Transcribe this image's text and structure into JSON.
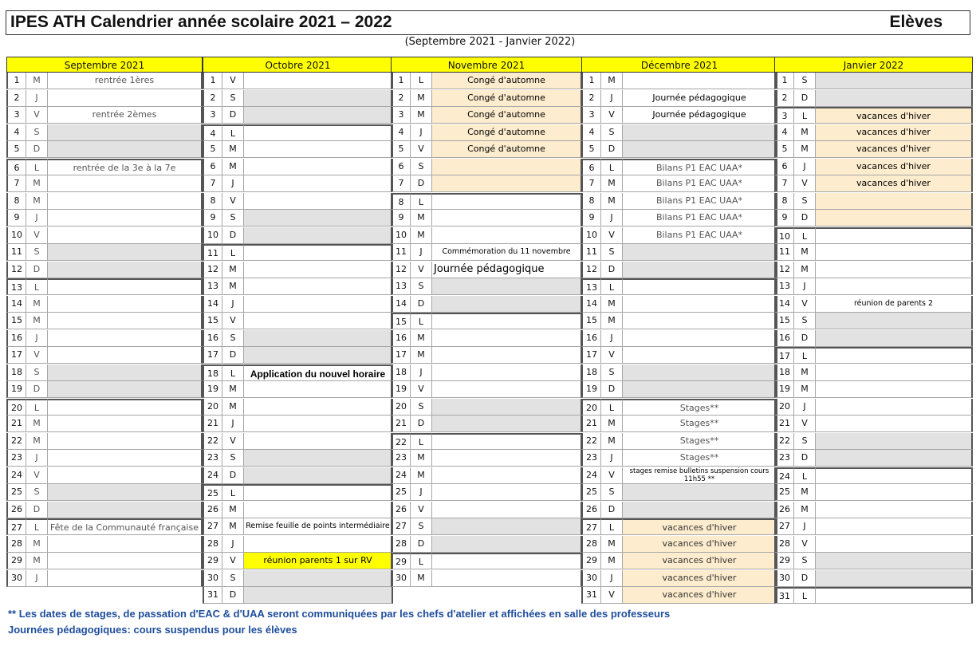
{
  "header": {
    "title": "IPES ATH Calendrier année scolaire 2021 – 2022",
    "audience": "Elèves"
  },
  "subtitle": "(Septembre 2021 - Janvier 2022)",
  "months": [
    {
      "name": "Septembre 2021",
      "days": [
        {
          "d": "1",
          "w": "M",
          "e": "rentrée 1ères"
        },
        {
          "d": "2",
          "w": "J",
          "e": ""
        },
        {
          "d": "3",
          "w": "V",
          "e": "rentrée 2èmes"
        },
        {
          "d": "4",
          "w": "S",
          "e": ""
        },
        {
          "d": "5",
          "w": "D",
          "e": ""
        },
        {
          "d": "6",
          "w": "L",
          "e": "rentrée de la 3e à la 7e"
        },
        {
          "d": "7",
          "w": "M",
          "e": ""
        },
        {
          "d": "8",
          "w": "M",
          "e": ""
        },
        {
          "d": "9",
          "w": "J",
          "e": ""
        },
        {
          "d": "10",
          "w": "V",
          "e": ""
        },
        {
          "d": "11",
          "w": "S",
          "e": ""
        },
        {
          "d": "12",
          "w": "D",
          "e": ""
        },
        {
          "d": "13",
          "w": "L",
          "e": ""
        },
        {
          "d": "14",
          "w": "M",
          "e": ""
        },
        {
          "d": "15",
          "w": "M",
          "e": ""
        },
        {
          "d": "16",
          "w": "J",
          "e": ""
        },
        {
          "d": "17",
          "w": "V",
          "e": ""
        },
        {
          "d": "18",
          "w": "S",
          "e": ""
        },
        {
          "d": "19",
          "w": "D",
          "e": ""
        },
        {
          "d": "20",
          "w": "L",
          "e": ""
        },
        {
          "d": "21",
          "w": "M",
          "e": ""
        },
        {
          "d": "22",
          "w": "M",
          "e": ""
        },
        {
          "d": "23",
          "w": "J",
          "e": ""
        },
        {
          "d": "24",
          "w": "V",
          "e": ""
        },
        {
          "d": "25",
          "w": "S",
          "e": ""
        },
        {
          "d": "26",
          "w": "D",
          "e": ""
        },
        {
          "d": "27",
          "w": "L",
          "e": "Fête de la Communauté française"
        },
        {
          "d": "28",
          "w": "M",
          "e": ""
        },
        {
          "d": "29",
          "w": "M",
          "e": ""
        },
        {
          "d": "30",
          "w": "J",
          "e": ""
        }
      ]
    },
    {
      "name": "Octobre 2021",
      "days": [
        {
          "d": "1",
          "w": "V",
          "e": ""
        },
        {
          "d": "2",
          "w": "S",
          "e": ""
        },
        {
          "d": "3",
          "w": "D",
          "e": ""
        },
        {
          "d": "4",
          "w": "L",
          "e": ""
        },
        {
          "d": "5",
          "w": "M",
          "e": ""
        },
        {
          "d": "6",
          "w": "M",
          "e": ""
        },
        {
          "d": "7",
          "w": "J",
          "e": ""
        },
        {
          "d": "8",
          "w": "V",
          "e": ""
        },
        {
          "d": "9",
          "w": "S",
          "e": ""
        },
        {
          "d": "10",
          "w": "D",
          "e": ""
        },
        {
          "d": "11",
          "w": "L",
          "e": ""
        },
        {
          "d": "12",
          "w": "M",
          "e": ""
        },
        {
          "d": "13",
          "w": "M",
          "e": ""
        },
        {
          "d": "14",
          "w": "J",
          "e": ""
        },
        {
          "d": "15",
          "w": "V",
          "e": ""
        },
        {
          "d": "16",
          "w": "S",
          "e": ""
        },
        {
          "d": "17",
          "w": "D",
          "e": ""
        },
        {
          "d": "18",
          "w": "L",
          "e": "Application du nouvel horaire"
        },
        {
          "d": "19",
          "w": "M",
          "e": ""
        },
        {
          "d": "20",
          "w": "M",
          "e": ""
        },
        {
          "d": "21",
          "w": "J",
          "e": ""
        },
        {
          "d": "22",
          "w": "V",
          "e": ""
        },
        {
          "d": "23",
          "w": "S",
          "e": ""
        },
        {
          "d": "24",
          "w": "D",
          "e": ""
        },
        {
          "d": "25",
          "w": "L",
          "e": ""
        },
        {
          "d": "26",
          "w": "M",
          "e": ""
        },
        {
          "d": "27",
          "w": "M",
          "e": "Remise feuille de points intermédiaire"
        },
        {
          "d": "28",
          "w": "J",
          "e": ""
        },
        {
          "d": "29",
          "w": "V",
          "e": "réunion parents 1 sur RV"
        },
        {
          "d": "30",
          "w": "S",
          "e": ""
        },
        {
          "d": "31",
          "w": "D",
          "e": ""
        }
      ]
    },
    {
      "name": "Novembre 2021",
      "days": [
        {
          "d": "1",
          "w": "L",
          "e": "Congé d'automne"
        },
        {
          "d": "2",
          "w": "M",
          "e": "Congé d'automne"
        },
        {
          "d": "3",
          "w": "M",
          "e": "Congé d'automne"
        },
        {
          "d": "4",
          "w": "J",
          "e": "Congé d'automne"
        },
        {
          "d": "5",
          "w": "V",
          "e": "Congé d'automne"
        },
        {
          "d": "6",
          "w": "S",
          "e": ""
        },
        {
          "d": "7",
          "w": "D",
          "e": ""
        },
        {
          "d": "8",
          "w": "L",
          "e": ""
        },
        {
          "d": "9",
          "w": "M",
          "e": ""
        },
        {
          "d": "10",
          "w": "M",
          "e": ""
        },
        {
          "d": "11",
          "w": "J",
          "e": "Commémoration du 11 novembre"
        },
        {
          "d": "12",
          "w": "V",
          "e": "Journée pédagogique"
        },
        {
          "d": "13",
          "w": "S",
          "e": ""
        },
        {
          "d": "14",
          "w": "D",
          "e": ""
        },
        {
          "d": "15",
          "w": "L",
          "e": ""
        },
        {
          "d": "16",
          "w": "M",
          "e": ""
        },
        {
          "d": "17",
          "w": "M",
          "e": ""
        },
        {
          "d": "18",
          "w": "J",
          "e": ""
        },
        {
          "d": "19",
          "w": "V",
          "e": ""
        },
        {
          "d": "20",
          "w": "S",
          "e": ""
        },
        {
          "d": "21",
          "w": "D",
          "e": ""
        },
        {
          "d": "22",
          "w": "L",
          "e": ""
        },
        {
          "d": "23",
          "w": "M",
          "e": ""
        },
        {
          "d": "24",
          "w": "M",
          "e": ""
        },
        {
          "d": "25",
          "w": "J",
          "e": ""
        },
        {
          "d": "26",
          "w": "V",
          "e": ""
        },
        {
          "d": "27",
          "w": "S",
          "e": ""
        },
        {
          "d": "28",
          "w": "D",
          "e": ""
        },
        {
          "d": "29",
          "w": "L",
          "e": ""
        },
        {
          "d": "30",
          "w": "M",
          "e": ""
        }
      ]
    },
    {
      "name": "Décembre 2021",
      "days": [
        {
          "d": "1",
          "w": "M",
          "e": ""
        },
        {
          "d": "2",
          "w": "J",
          "e": "Journée pédagogique"
        },
        {
          "d": "3",
          "w": "V",
          "e": "Journée pédagogique"
        },
        {
          "d": "4",
          "w": "S",
          "e": ""
        },
        {
          "d": "5",
          "w": "D",
          "e": ""
        },
        {
          "d": "6",
          "w": "L",
          "e": "Bilans P1 EAC UAA*"
        },
        {
          "d": "7",
          "w": "M",
          "e": "Bilans P1 EAC UAA*"
        },
        {
          "d": "8",
          "w": "M",
          "e": "Bilans P1 EAC UAA*"
        },
        {
          "d": "9",
          "w": "J",
          "e": "Bilans P1 EAC UAA*"
        },
        {
          "d": "10",
          "w": "V",
          "e": "Bilans P1 EAC UAA*"
        },
        {
          "d": "11",
          "w": "S",
          "e": ""
        },
        {
          "d": "12",
          "w": "D",
          "e": ""
        },
        {
          "d": "13",
          "w": "L",
          "e": ""
        },
        {
          "d": "14",
          "w": "M",
          "e": ""
        },
        {
          "d": "15",
          "w": "M",
          "e": ""
        },
        {
          "d": "16",
          "w": "J",
          "e": ""
        },
        {
          "d": "17",
          "w": "V",
          "e": ""
        },
        {
          "d": "18",
          "w": "S",
          "e": ""
        },
        {
          "d": "19",
          "w": "D",
          "e": ""
        },
        {
          "d": "20",
          "w": "L",
          "e": "Stages**"
        },
        {
          "d": "21",
          "w": "M",
          "e": "Stages**"
        },
        {
          "d": "22",
          "w": "M",
          "e": "Stages**"
        },
        {
          "d": "23",
          "w": "J",
          "e": "Stages**"
        },
        {
          "d": "24",
          "w": "V",
          "e": "stages remise bulletins suspension cours 11h55 **"
        },
        {
          "d": "25",
          "w": "S",
          "e": ""
        },
        {
          "d": "26",
          "w": "D",
          "e": ""
        },
        {
          "d": "27",
          "w": "L",
          "e": "vacances d'hiver"
        },
        {
          "d": "28",
          "w": "M",
          "e": "vacances d'hiver"
        },
        {
          "d": "29",
          "w": "M",
          "e": "vacances d'hiver"
        },
        {
          "d": "30",
          "w": "J",
          "e": "vacances d'hiver"
        },
        {
          "d": "31",
          "w": "V",
          "e": "vacances d'hiver"
        }
      ]
    },
    {
      "name": "Janvier 2022",
      "days": [
        {
          "d": "1",
          "w": "S",
          "e": ""
        },
        {
          "d": "2",
          "w": "D",
          "e": ""
        },
        {
          "d": "3",
          "w": "L",
          "e": "vacances d'hiver"
        },
        {
          "d": "4",
          "w": "M",
          "e": "vacances d'hiver"
        },
        {
          "d": "5",
          "w": "M",
          "e": "vacances d'hiver"
        },
        {
          "d": "6",
          "w": "J",
          "e": "vacances d'hiver"
        },
        {
          "d": "7",
          "w": "V",
          "e": "vacances d'hiver"
        },
        {
          "d": "8",
          "w": "S",
          "e": ""
        },
        {
          "d": "9",
          "w": "D",
          "e": ""
        },
        {
          "d": "10",
          "w": "L",
          "e": ""
        },
        {
          "d": "11",
          "w": "M",
          "e": ""
        },
        {
          "d": "12",
          "w": "M",
          "e": ""
        },
        {
          "d": "13",
          "w": "J",
          "e": ""
        },
        {
          "d": "14",
          "w": "V",
          "e": "réunion de parents 2"
        },
        {
          "d": "15",
          "w": "S",
          "e": ""
        },
        {
          "d": "16",
          "w": "D",
          "e": ""
        },
        {
          "d": "17",
          "w": "L",
          "e": ""
        },
        {
          "d": "18",
          "w": "M",
          "e": ""
        },
        {
          "d": "19",
          "w": "M",
          "e": ""
        },
        {
          "d": "20",
          "w": "J",
          "e": ""
        },
        {
          "d": "21",
          "w": "V",
          "e": ""
        },
        {
          "d": "22",
          "w": "S",
          "e": ""
        },
        {
          "d": "23",
          "w": "D",
          "e": ""
        },
        {
          "d": "24",
          "w": "L",
          "e": ""
        },
        {
          "d": "25",
          "w": "M",
          "e": ""
        },
        {
          "d": "26",
          "w": "M",
          "e": ""
        },
        {
          "d": "27",
          "w": "J",
          "e": ""
        },
        {
          "d": "28",
          "w": "V",
          "e": ""
        },
        {
          "d": "29",
          "w": "S",
          "e": ""
        },
        {
          "d": "30",
          "w": "D",
          "e": ""
        },
        {
          "d": "31",
          "w": "L",
          "e": ""
        }
      ]
    }
  ],
  "colors": {
    "weekend": "#e2e2e2",
    "holiday": "#fdeccd",
    "highlight": "#ffff00",
    "header": "#ffff00",
    "note": "#1f4e9c"
  },
  "notes": [
    "** Les dates de stages, de passation d'EAC & d'UAA seront communiquées par les chefs d'atelier et affichées en salle des professeurs",
    "Journées pédagogiques: cours suspendus pour les élèves"
  ]
}
